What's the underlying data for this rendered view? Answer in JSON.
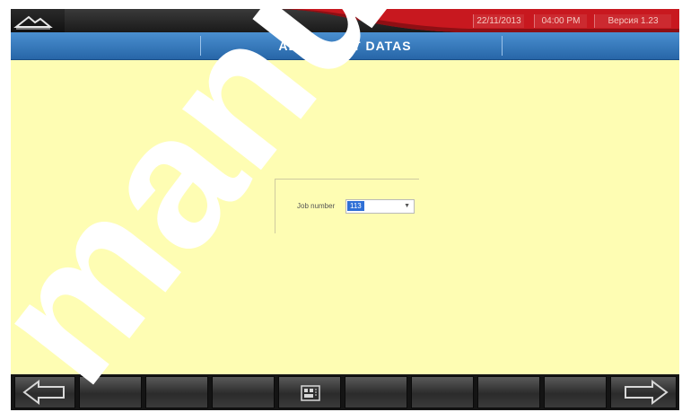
{
  "status_bar": {
    "date": "22/11/2013",
    "time": "04:00 PM",
    "version": "Версия 1.23"
  },
  "header": {
    "title": "ALIGNMENT DATAS"
  },
  "job": {
    "label": "Job number",
    "value": "113"
  },
  "toolbar": {
    "buttons": [
      {
        "icon": "back-arrow-icon"
      },
      {
        "icon": ""
      },
      {
        "icon": ""
      },
      {
        "icon": ""
      },
      {
        "icon": "keyboard-icon"
      },
      {
        "icon": ""
      },
      {
        "icon": ""
      },
      {
        "icon": ""
      },
      {
        "icon": ""
      },
      {
        "icon": "forward-arrow-icon"
      }
    ]
  },
  "watermark": {
    "text": "manual"
  },
  "colors": {
    "background": "#fefdb3",
    "header": "#3a7dc0",
    "status_red": "#c8181f",
    "watermark": "#ffffff"
  }
}
